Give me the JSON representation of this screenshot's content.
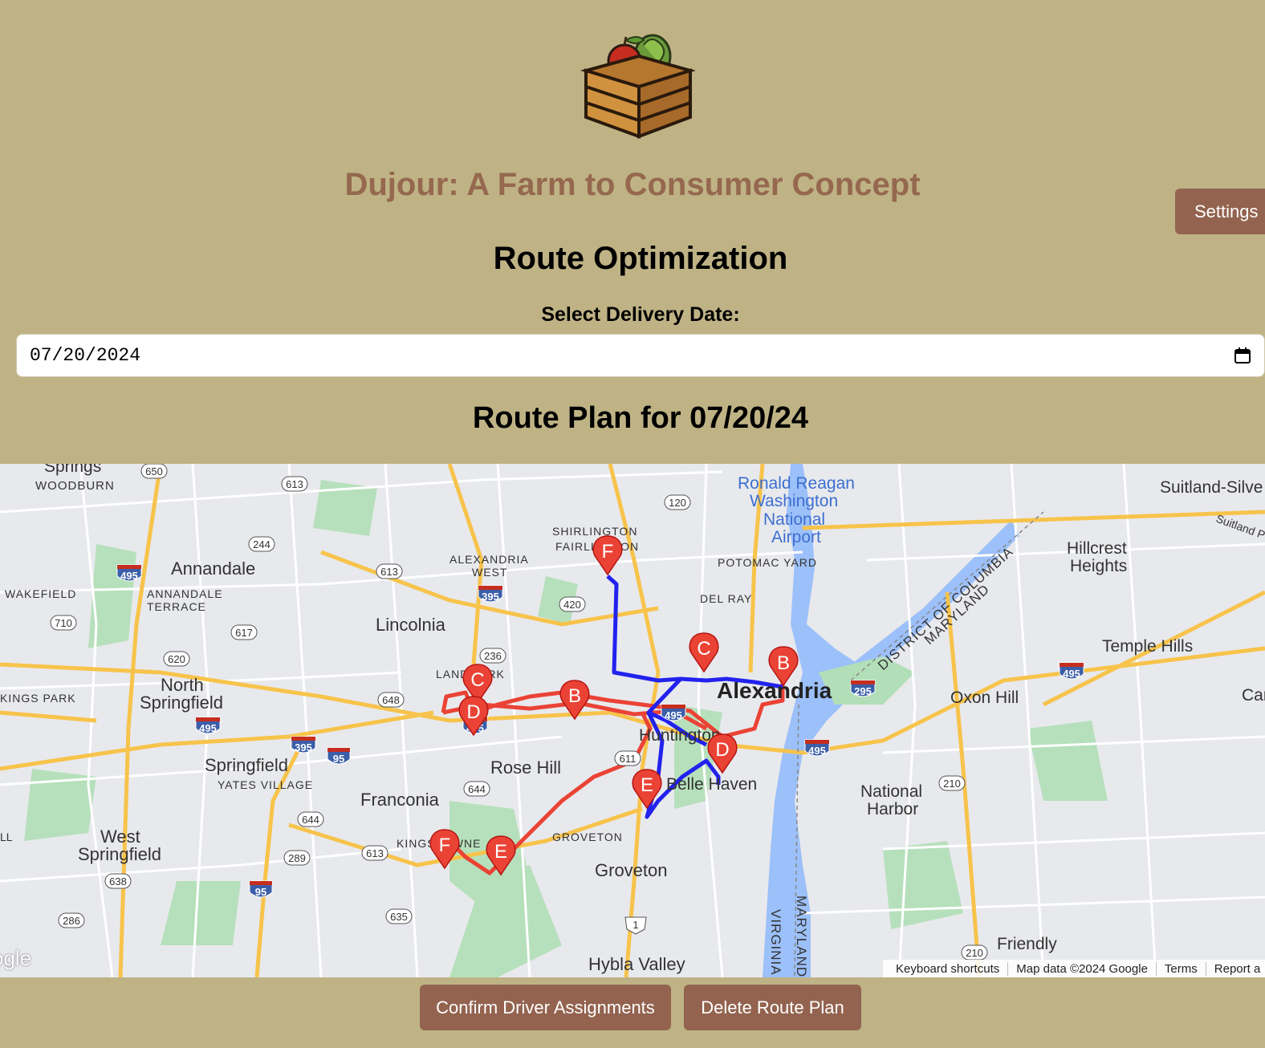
{
  "header": {
    "app_title": "Dujour: A Farm to Consumer Concept",
    "settings_label": "Settings"
  },
  "page": {
    "heading": "Route Optimization",
    "date_label": "Select Delivery Date:",
    "date_value": "07/20/2024",
    "route_heading": "Route Plan for 07/20/24"
  },
  "map": {
    "places": [
      {
        "id": "springs",
        "text": "Springs"
      },
      {
        "id": "woodburn",
        "text": "WOODBURN"
      },
      {
        "id": "annandale",
        "text": "Annandale"
      },
      {
        "id": "annandale-terrace-1",
        "text": "ANNANDALE"
      },
      {
        "id": "annandale-terrace-2",
        "text": "TERRACE"
      },
      {
        "id": "wakefield",
        "text": "WAKEFIELD"
      },
      {
        "id": "lincolnia",
        "text": "Lincolnia"
      },
      {
        "id": "north-springfield-1",
        "text": "North"
      },
      {
        "id": "north-springfield-2",
        "text": "Springfield"
      },
      {
        "id": "kings-park",
        "text": "KINGS PARK"
      },
      {
        "id": "springfield",
        "text": "Springfield"
      },
      {
        "id": "yates-village",
        "text": "YATES VILLAGE"
      },
      {
        "id": "west-springfield-1",
        "text": "West"
      },
      {
        "id": "west-springfield-2",
        "text": "Springfield"
      },
      {
        "id": "franconia",
        "text": "Franconia"
      },
      {
        "id": "kingstowne",
        "text": "KINGSTOWNE"
      },
      {
        "id": "rose-hill",
        "text": "Rose Hill"
      },
      {
        "id": "groveton-upper",
        "text": "GROVETON"
      },
      {
        "id": "groveton",
        "text": "Groveton"
      },
      {
        "id": "hybla-valley",
        "text": "Hybla Valley"
      },
      {
        "id": "alexandria-west-1",
        "text": "ALEXANDRIA"
      },
      {
        "id": "alexandria-west-2",
        "text": "WEST"
      },
      {
        "id": "shirlington",
        "text": "SHIRLINGTON"
      },
      {
        "id": "fairlington",
        "text": "FAIRLINGTON"
      },
      {
        "id": "potomac-yard",
        "text": "POTOMAC YARD"
      },
      {
        "id": "del-ray",
        "text": "DEL RAY"
      },
      {
        "id": "landmark",
        "text": "LANDMARK"
      },
      {
        "id": "alexandria",
        "text": "Alexandria"
      },
      {
        "id": "huntington",
        "text": "Huntington"
      },
      {
        "id": "belle-haven",
        "text": "Belle Haven"
      },
      {
        "id": "airport-1",
        "text": "Ronald Reagan"
      },
      {
        "id": "airport-2",
        "text": "Washington"
      },
      {
        "id": "airport-3",
        "text": "National"
      },
      {
        "id": "airport-4",
        "text": "Airport"
      },
      {
        "id": "dc-line",
        "text": "DISTRICT OF COLUMBIA"
      },
      {
        "id": "md-line",
        "text": "MARYLAND"
      },
      {
        "id": "suitland",
        "text": "Suitland-Silve"
      },
      {
        "id": "suitland-pkwy",
        "text": "Suitland P"
      },
      {
        "id": "hillcrest-1",
        "text": "Hillcrest"
      },
      {
        "id": "hillcrest-2",
        "text": "Heights"
      },
      {
        "id": "temple-hills",
        "text": "Temple Hills"
      },
      {
        "id": "oxon-hill",
        "text": "Oxon Hill"
      },
      {
        "id": "national-harbor-1",
        "text": "National"
      },
      {
        "id": "national-harbor-2",
        "text": "Harbor"
      },
      {
        "id": "friendly",
        "text": "Friendly"
      },
      {
        "id": "virginia",
        "text": "VIRGINIA"
      },
      {
        "id": "maryland-v",
        "text": "MARYLAND"
      },
      {
        "id": "car",
        "text": "Car"
      },
      {
        "id": "ll",
        "text": "LL"
      }
    ],
    "shields": [
      {
        "id": "r650",
        "text": "650"
      },
      {
        "id": "r613a",
        "text": "613"
      },
      {
        "id": "r244",
        "text": "244"
      },
      {
        "id": "r613b",
        "text": "613"
      },
      {
        "id": "r120",
        "text": "120"
      },
      {
        "id": "r420",
        "text": "420"
      },
      {
        "id": "r710",
        "text": "710"
      },
      {
        "id": "r617",
        "text": "617"
      },
      {
        "id": "r620",
        "text": "620"
      },
      {
        "id": "r648",
        "text": "648"
      },
      {
        "id": "r644a",
        "text": "644"
      },
      {
        "id": "r644b",
        "text": "644"
      },
      {
        "id": "r611",
        "text": "611"
      },
      {
        "id": "r289",
        "text": "289"
      },
      {
        "id": "r613c",
        "text": "613"
      },
      {
        "id": "r638",
        "text": "638"
      },
      {
        "id": "r635",
        "text": "635"
      },
      {
        "id": "r286",
        "text": "286"
      },
      {
        "id": "r1",
        "text": "1"
      },
      {
        "id": "r210a",
        "text": "210"
      },
      {
        "id": "r210b",
        "text": "210"
      },
      {
        "id": "r236",
        "text": "236"
      }
    ],
    "interstates": [
      {
        "id": "i495a",
        "text": "495"
      },
      {
        "id": "i395a",
        "text": "395"
      },
      {
        "id": "i495b",
        "text": "495"
      },
      {
        "id": "i395b",
        "text": "395"
      },
      {
        "id": "i95a",
        "text": "95"
      },
      {
        "id": "i495c",
        "text": "495"
      },
      {
        "id": "i95b",
        "text": "95"
      },
      {
        "id": "i495d",
        "text": "495"
      },
      {
        "id": "i295",
        "text": "295"
      },
      {
        "id": "i495e",
        "text": "495"
      },
      {
        "id": "i495f",
        "text": "495"
      }
    ],
    "markers": [
      {
        "id": "red-c",
        "letter": "C",
        "route": "red"
      },
      {
        "id": "red-d",
        "letter": "D",
        "route": "red"
      },
      {
        "id": "red-b1",
        "letter": "B",
        "route": "red"
      },
      {
        "id": "red-e",
        "letter": "E",
        "route": "red"
      },
      {
        "id": "red-f",
        "letter": "F",
        "route": "red"
      },
      {
        "id": "blue-f",
        "letter": "F",
        "route": "blue"
      },
      {
        "id": "blue-c",
        "letter": "C",
        "route": "blue"
      },
      {
        "id": "blue-b",
        "letter": "B",
        "route": "blue"
      },
      {
        "id": "blue-d",
        "letter": "D",
        "route": "blue"
      },
      {
        "id": "blue-e",
        "letter": "E",
        "route": "blue"
      }
    ],
    "footer": {
      "shortcuts": "Keyboard shortcuts",
      "data": "Map data ©2024 Google",
      "terms": "Terms",
      "report": "Report a"
    },
    "google_mark": "ogle",
    "colors": {
      "route_red": "#ea4335",
      "route_blue": "#2222ee",
      "water": "#9cc0f9",
      "park": "#b2dfb8",
      "highway": "#f9c94c"
    }
  },
  "actions": {
    "confirm_label": "Confirm Driver Assignments",
    "delete_label": "Delete Route Plan"
  }
}
